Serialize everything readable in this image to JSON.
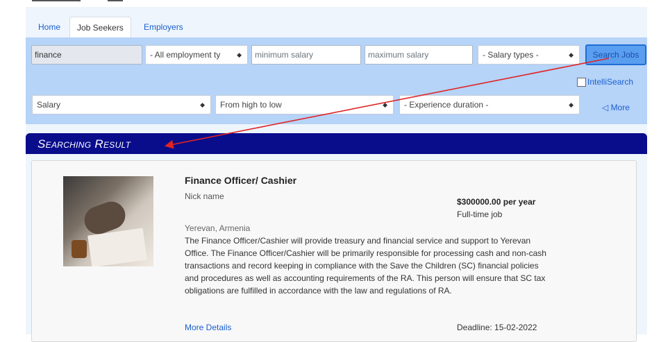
{
  "tabs": [
    {
      "label": "Home",
      "active": false
    },
    {
      "label": "Job Seekers",
      "active": true
    },
    {
      "label": "Employers",
      "active": false
    }
  ],
  "search": {
    "keyword_value": "finance",
    "employment_type": "- All employment ty",
    "min_salary_placeholder": "minimum salary",
    "max_salary_placeholder": "maximum salary",
    "salary_types": "- Salary types -",
    "search_button": "Search Jobs",
    "intellisearch_label": "IntelliSearch",
    "sort_field": "Salary",
    "sort_order": "From high to low",
    "experience": "- Experience duration -",
    "more_label": "◁ More"
  },
  "results": {
    "header": "Searching Result",
    "items": [
      {
        "title": "Finance Officer/ Cashier",
        "company": "Nick name",
        "salary": "$300000.00 per year",
        "job_type": "Full-time job",
        "location": "Yerevan, Armenia",
        "description": "The Finance Officer/Cashier will provide treasury and financial service and support to Yerevan Office. The Finance Officer/Cashier will be primarily responsible for processing cash and non-cash transactions and record keeping in compliance with the Save the Children (SC) financial policies and procedures as well as accounting requirements of the RA. This person will ensure that SC tax obligations are fulfilled in accordance with the law and regulations of RA.",
        "details_link": "More Details",
        "deadline": "Deadline: 15-02-2022"
      }
    ]
  },
  "colors": {
    "accent": "#1a5fd0",
    "panel": "#b6d3f8",
    "header_bg": "#090c8b",
    "annotation_arrow": "#e02424"
  }
}
